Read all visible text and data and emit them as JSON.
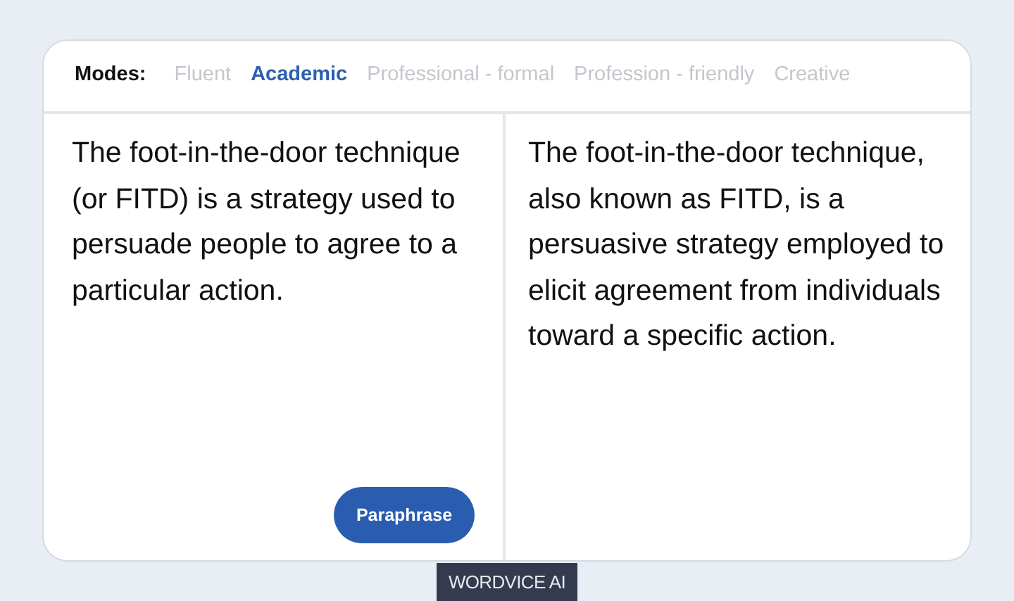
{
  "modes": {
    "label": "Modes:",
    "items": [
      {
        "label": "Fluent",
        "selected": false
      },
      {
        "label": "Academic",
        "selected": true
      },
      {
        "label": "Professional - formal",
        "selected": false
      },
      {
        "label": "Profession - friendly",
        "selected": false
      },
      {
        "label": "Creative",
        "selected": false
      }
    ]
  },
  "input_text": "The foot-in-the-door technique (or FITD) is a strategy used to persuade people to agree to a particular action.",
  "paraphrase_button": "Paraphrase",
  "output_text": "The foot-in-the-door technique, also known as FITD, is a persuasive strategy employed to elicit agreement from individuals toward a specific action.",
  "brand_tag": "WORDVICE AI"
}
